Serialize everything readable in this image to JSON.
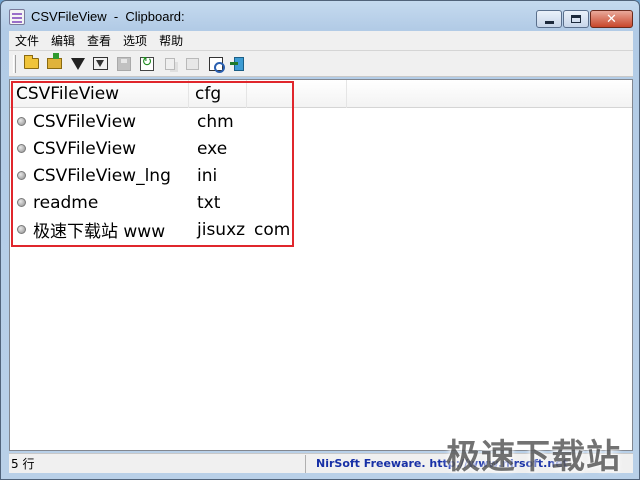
{
  "window": {
    "title": "CSVFileView  -  Clipboard:"
  },
  "caption": {
    "minimize": "",
    "maximize": "",
    "close": "✕"
  },
  "menu": [
    "文件",
    "编辑",
    "查看",
    "选项",
    "帮助"
  ],
  "toolbar": {
    "icons": [
      "open-folder-icon",
      "open-arrow-icon",
      "filter-icon",
      "filter-box-icon",
      "save-icon",
      "refresh-icon",
      "copy-icon",
      "properties-icon",
      "find-icon",
      "exit-icon"
    ]
  },
  "table": {
    "headers": [
      "CSVFileView",
      "cfg",
      "",
      ""
    ],
    "rows": [
      [
        "CSVFileView",
        "chm",
        ""
      ],
      [
        "CSVFileView",
        "exe",
        ""
      ],
      [
        "CSVFileView_lng",
        "ini",
        ""
      ],
      [
        "readme",
        "txt",
        ""
      ],
      [
        "极速下载站 www",
        "jisuxz",
        "com"
      ]
    ]
  },
  "status": {
    "count": "5 行",
    "link": "NirSoft Freeware.  http://www.nirsoft.net"
  },
  "watermark": "极速下载站",
  "colors": {
    "highlight": "#e0262c",
    "link": "#1730a6"
  }
}
